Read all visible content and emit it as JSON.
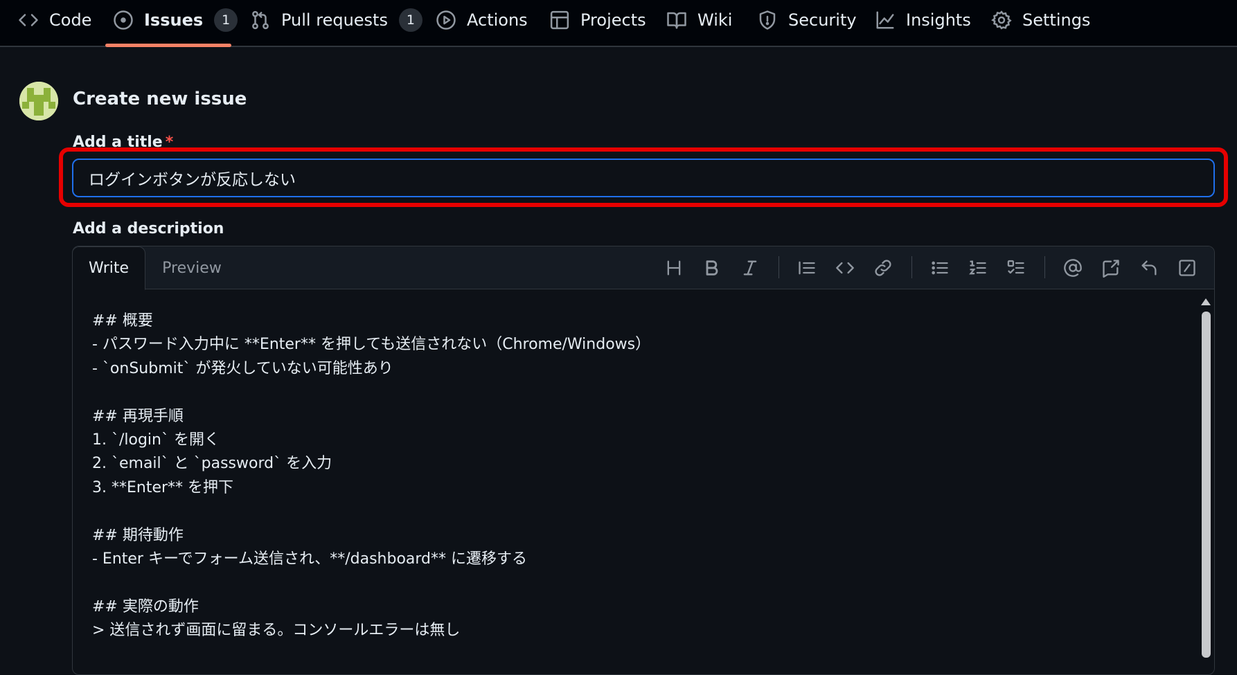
{
  "nav": {
    "tabs": [
      {
        "label": "Code",
        "icon": "code-icon"
      },
      {
        "label": "Issues",
        "icon": "issue-opened-icon",
        "count": "1",
        "selected": true
      },
      {
        "label": "Pull requests",
        "icon": "git-pull-request-icon",
        "count": "1"
      },
      {
        "label": "Actions",
        "icon": "play-icon"
      },
      {
        "label": "Projects",
        "icon": "table-icon"
      },
      {
        "label": "Wiki",
        "icon": "book-icon"
      },
      {
        "label": "Security",
        "icon": "shield-icon"
      },
      {
        "label": "Insights",
        "icon": "graph-icon"
      },
      {
        "label": "Settings",
        "icon": "gear-icon"
      }
    ],
    "active_underline_color": "#f78166"
  },
  "form": {
    "heading": "Create new issue",
    "title_label": "Add a title",
    "required_mark": "*",
    "title_value": "ログインボタンが反応しない",
    "description_label": "Add a description",
    "editor_tabs": {
      "write": "Write",
      "preview": "Preview"
    },
    "toolbar": [
      "heading-icon",
      "bold-icon",
      "italic-icon",
      "quote-icon",
      "code-icon",
      "link-icon",
      "unordered-list-icon",
      "ordered-list-icon",
      "task-list-icon",
      "mention-icon",
      "cross-reference-icon",
      "reply-icon",
      "slash-commands-icon"
    ],
    "description_value": "## 概要\n- パスワード入力中に **Enter** を押しても送信されない（Chrome/Windows）\n- `onSubmit` が発火していない可能性あり\n\n## 再現手順\n1. `/login` を開く\n2. `email` と `password` を入力\n3. **Enter** を押下\n\n## 期待動作\n- Enter キーでフォーム送信され、**/dashboard** に遷移する\n\n## 実際の動作\n> 送信されず画面に留まる。コンソールエラーは無し"
  },
  "colors": {
    "background": "#0d1117",
    "focus_border": "#1f6feb",
    "highlight_annotation": "#e60000",
    "required": "#f85149"
  }
}
